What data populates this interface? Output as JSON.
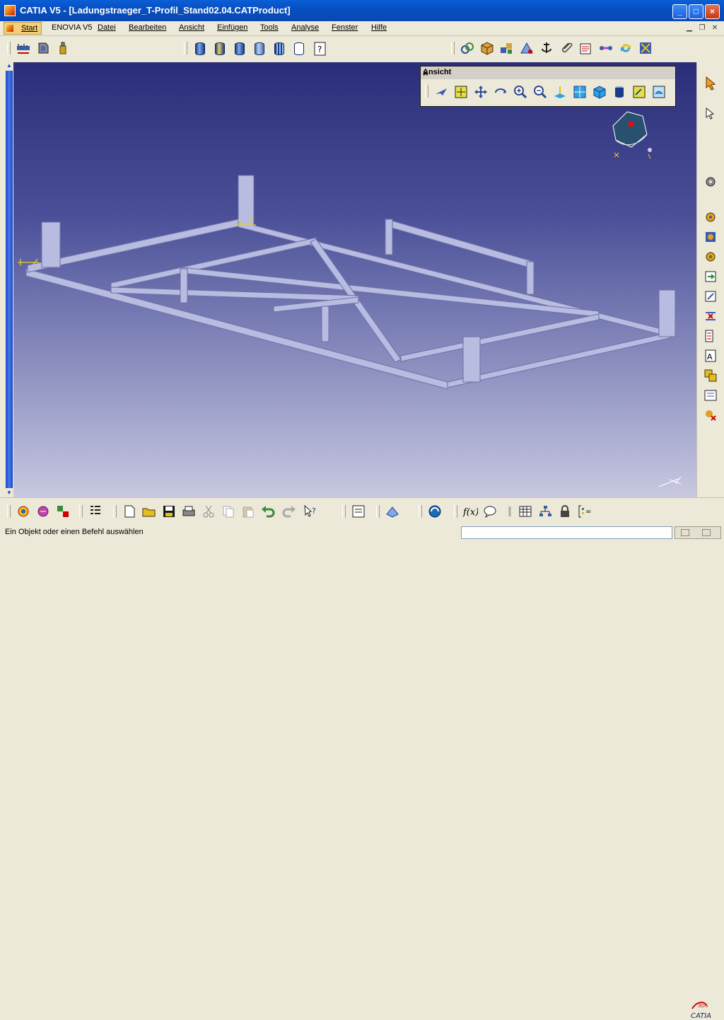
{
  "window": {
    "title": "CATIA V5 - [Ladungstraeger_T-Profil_Stand02.04.CATProduct]",
    "minimize": "_",
    "maximize": "□",
    "close": "×"
  },
  "menu": {
    "items": [
      "Start",
      "ENOVIA V5",
      "Datei",
      "Bearbeiten",
      "Ansicht",
      "Einfügen",
      "Tools",
      "Analyse",
      "Fenster",
      "Hilfe"
    ]
  },
  "view_toolbar": {
    "title": "Ansicht",
    "close": "×",
    "icons": [
      "fly-mode-icon",
      "fit-all-icon",
      "pan-icon",
      "rotate-icon",
      "zoom-in-icon",
      "zoom-out-icon",
      "normal-view-icon",
      "multi-view-icon",
      "iso-view-icon",
      "shading-icon",
      "hide-show-icon",
      "swap-visible-icon"
    ]
  },
  "status": {
    "message": "Ein Objekt oder einen Befehl auswählen",
    "command_input": ""
  },
  "brand": {
    "logo_text": "CATIA",
    "logo_mark": "3DS"
  },
  "colors": {
    "titlebar": "#0850c0",
    "viewport_top": "#2a2e78",
    "viewport_bottom": "#c8c8e0",
    "beam": "#b8bce0",
    "beam_edge": "#6c70a8",
    "accent": "#f3cf7a"
  }
}
